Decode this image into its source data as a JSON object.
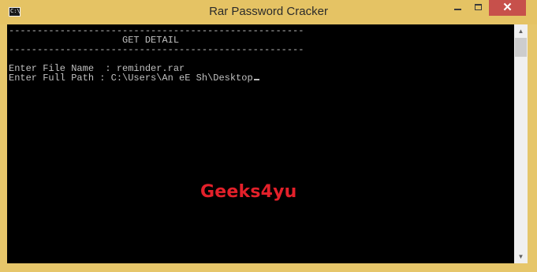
{
  "window": {
    "title": "Rar Password Cracker",
    "icon": "console-icon",
    "icon_text": "C:\\",
    "controls": {
      "minimize": "minimize-icon",
      "maximize": "maximize-icon",
      "close_label": "✕"
    }
  },
  "console": {
    "separator": "----------------------------------------------------",
    "heading": "GET DETAIL",
    "lines": {
      "file_name": "Enter File Name  : reminder.rar",
      "full_path": "Enter Full Path : C:\\Users\\An eE Sh\\Desktop"
    },
    "text_color": "#c0c0c0",
    "background": "#000000"
  },
  "watermark": {
    "text": "Geeks4yu",
    "color": "#e3202a"
  },
  "scrollbar": {
    "up": "▲",
    "down": "▼"
  }
}
